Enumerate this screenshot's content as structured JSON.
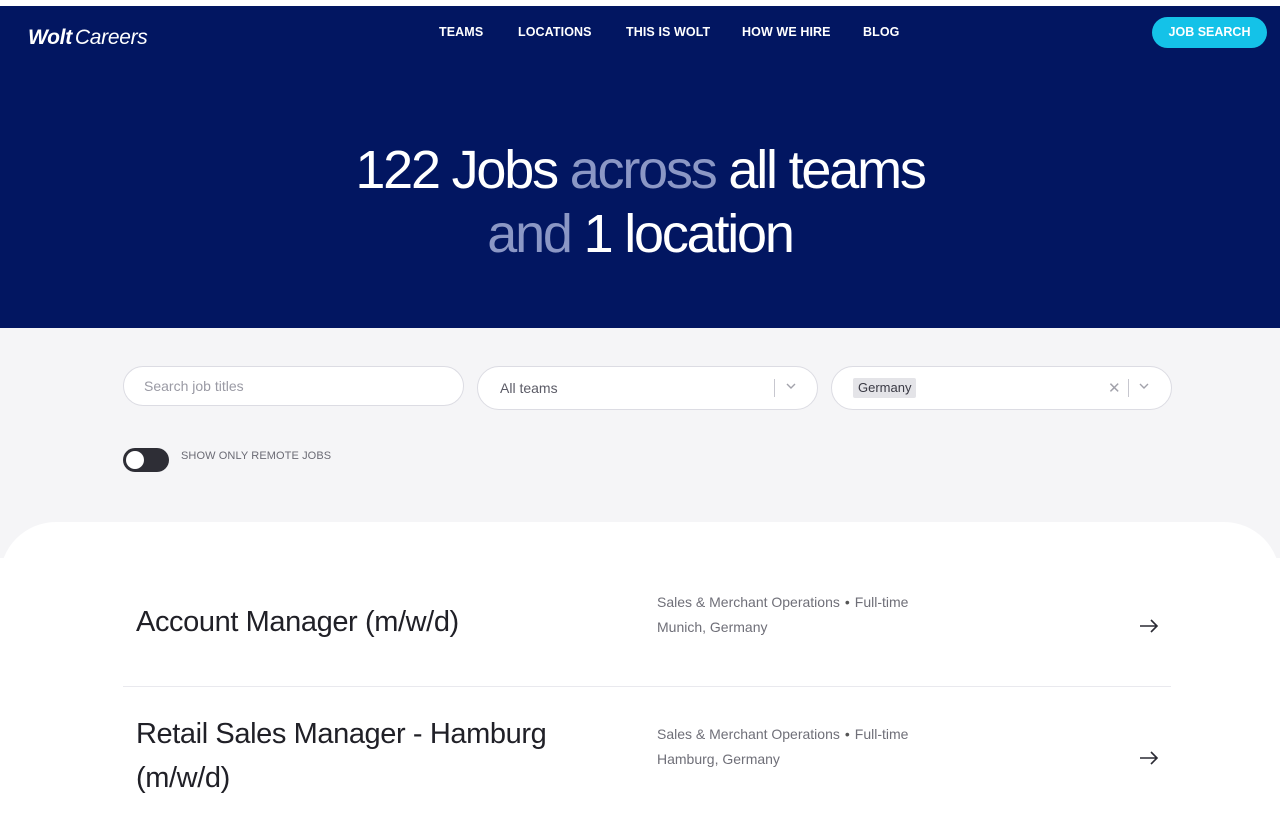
{
  "header": {
    "logo_brand": "Wolt",
    "logo_sub": "Careers",
    "nav": [
      "TEAMS",
      "LOCATIONS",
      "THIS IS WOLT",
      "HOW WE HIRE",
      "BLOG"
    ],
    "job_search_label": "JOB SEARCH"
  },
  "hero": {
    "count": "122 Jobs",
    "across": "across",
    "all_teams": "all teams",
    "and": "and",
    "location_count": "1 location"
  },
  "filters": {
    "search_placeholder": "Search job titles",
    "teams_value": "All teams",
    "location_chip": "Germany",
    "remote_toggle_label": "SHOW ONLY REMOTE JOBS",
    "remote_toggle_on": false
  },
  "jobs": [
    {
      "title": "Account Manager (m/w/d)",
      "team": "Sales & Merchant Operations",
      "type": "Full-time",
      "location": "Munich, Germany"
    },
    {
      "title": "Retail Sales Manager - Hamburg (m/w/d)",
      "team": "Sales & Merchant Operations",
      "type": "Full-time",
      "location": "Hamburg, Germany"
    }
  ],
  "colors": {
    "hero_bg": "#021661",
    "accent": "#14c2e8",
    "dim_text": "#8b97c5"
  }
}
